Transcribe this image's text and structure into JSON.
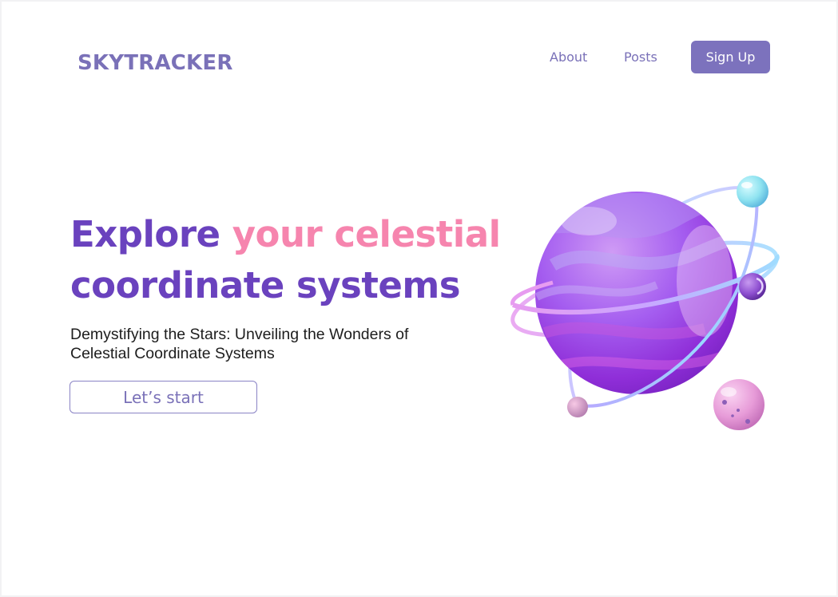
{
  "header": {
    "logo": "SKYTRACKER",
    "nav": {
      "about": "About",
      "posts": "Posts"
    },
    "signup_label": "Sign Up"
  },
  "hero": {
    "title_part1": "Explore ",
    "title_highlight": "your celestial",
    "title_part2": "coordinate systems",
    "subtitle": "Demystifying the Stars: Unveiling the Wonders of Celestial Coordinate Systems",
    "cta_label": "Let’s start"
  },
  "colors": {
    "brand": "#7a71b8",
    "title": "#6a42be",
    "highlight": "#f685ae",
    "button": "#7c72bd"
  },
  "illustration": {
    "icon": "planet-illustration"
  }
}
